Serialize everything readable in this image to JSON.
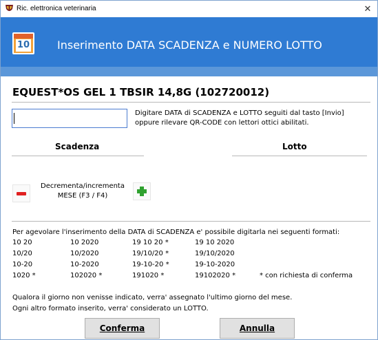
{
  "window": {
    "title": "Ric. elettronica veterinaria",
    "close_glyph": "✕"
  },
  "header": {
    "icon": "calendar-icon",
    "icon_number": "10",
    "title": "Inserimento DATA SCADENZA e NUMERO LOTTO",
    "colors": {
      "primary": "#2f7bd3",
      "band": "#5b97d9"
    }
  },
  "product": {
    "name": "EQUEST*OS GEL 1 TBSIR 14,8G (102720012)"
  },
  "input": {
    "value": "",
    "instructions_line1": "Digitare DATA di SCADENZA e LOTTO seguiti dal tasto [Invio]",
    "instructions_line2": "oppure rilevare QR-CODE con lettori ottici abilitati."
  },
  "columns": {
    "scadenza": "Scadenza",
    "lotto": "Lotto"
  },
  "stepper": {
    "label_line1": "Decrementa/incrementa",
    "label_line2": "MESE (F3 / F4)",
    "minus_icon": "minus-icon",
    "plus_icon": "plus-icon"
  },
  "formats": {
    "intro": "Per agevolare l'inserimento della DATA di SCADENZA e' possibile digitarla nei seguenti formati:",
    "rows": [
      [
        "10 20",
        "10 2020",
        "19 10 20 *",
        "19 10 2020",
        ""
      ],
      [
        "10/20",
        "10/2020",
        "19/10/20 *",
        "19/10/2020",
        ""
      ],
      [
        "10-20",
        "10-2020",
        "19-10-20 *",
        "19-10-2020",
        ""
      ],
      [
        "1020 *",
        "102020 *",
        "191020 *",
        "19102020 *",
        "* con richiesta di conferma"
      ]
    ]
  },
  "notes": {
    "line1": "Qualora il giorno non venisse indicato, verra' assegnato l'ultimo giorno del mese.",
    "line2": "Ogni altro formato inserito, verra' considerato un LOTTO."
  },
  "buttons": {
    "confirm": "Conferma",
    "cancel": "Annulla"
  }
}
